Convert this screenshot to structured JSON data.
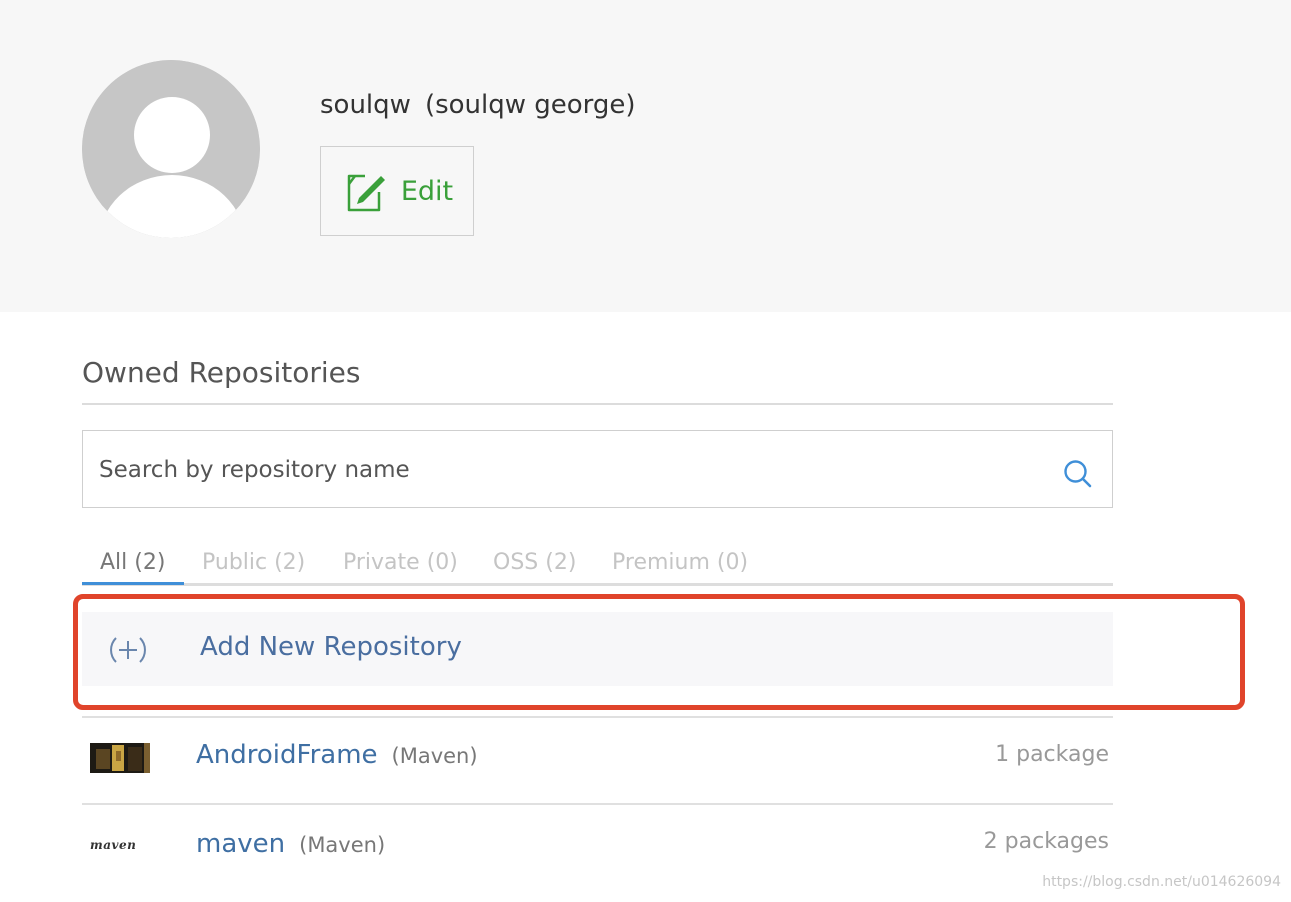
{
  "profile": {
    "username": "soulqw",
    "full_name": "(soulqw george)",
    "edit_label": "Edit",
    "avatar_icon": "default-user-avatar"
  },
  "repositories": {
    "section_title": "Owned Repositories",
    "search": {
      "placeholder": "Search by repository name",
      "value": "",
      "icon": "search-icon"
    },
    "tabs": [
      {
        "label": "All (2)",
        "active": true
      },
      {
        "label": "Public (2)",
        "active": false
      },
      {
        "label": "Private (0)",
        "active": false
      },
      {
        "label": "OSS (2)",
        "active": false
      },
      {
        "label": "Premium (0)",
        "active": false
      }
    ],
    "add_new": {
      "label": "Add New Repository",
      "icon": "plus-circle-icon"
    },
    "items": [
      {
        "name": "AndroidFrame",
        "type": "(Maven)",
        "packages": "1 package",
        "thumbnail": "repository-thumbnail"
      },
      {
        "name": "maven",
        "type": "(Maven)",
        "packages": "2 packages",
        "thumbnail": "maven-logo",
        "logo_text": "maven"
      }
    ]
  },
  "colors": {
    "header_bg": "#f7f7f7",
    "edit_green": "#3aa03a",
    "link_blue": "#3f6fa3",
    "tab_active_underline": "#3f8fd8",
    "highlight_red": "#e0442b"
  },
  "watermark": "https://blog.csdn.net/u014626094"
}
